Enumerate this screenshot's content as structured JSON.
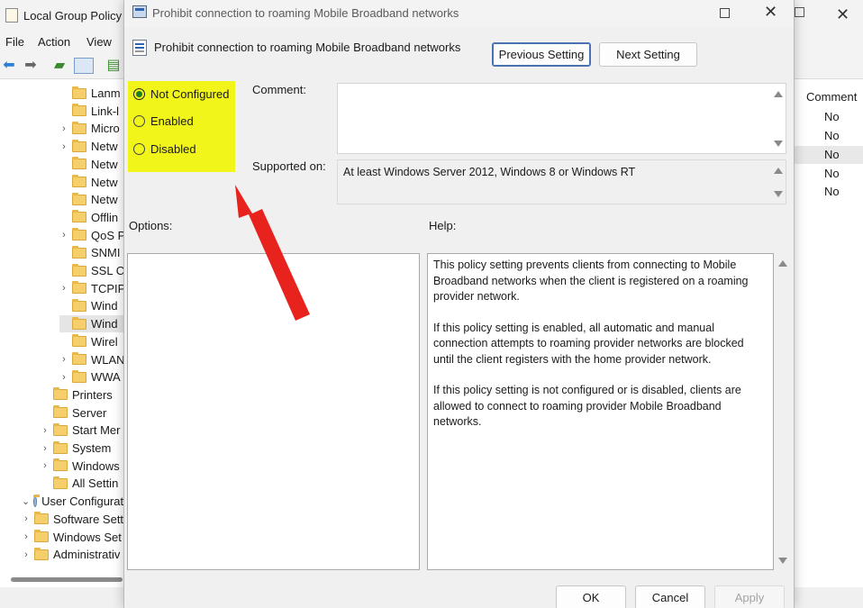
{
  "bg_window": {
    "title": "Local Group Policy",
    "close_glyph": "✕",
    "menu": [
      "File",
      "Action",
      "View"
    ],
    "toolbar_icons": [
      "back-arrow-icon",
      "forward-arrow-icon",
      "up-folder-icon",
      "show-hide-tree-icon",
      "export-list-icon"
    ]
  },
  "tree": {
    "items": [
      {
        "label": "Lanm",
        "chevron": false
      },
      {
        "label": "Link-l",
        "chevron": false
      },
      {
        "label": "Micro",
        "chevron": true
      },
      {
        "label": "Netw",
        "chevron": true
      },
      {
        "label": "Netw",
        "chevron": false
      },
      {
        "label": "Netw",
        "chevron": false
      },
      {
        "label": "Netw",
        "chevron": false
      },
      {
        "label": "Offlin",
        "chevron": false
      },
      {
        "label": "QoS P",
        "chevron": true
      },
      {
        "label": "SNMI",
        "chevron": false
      },
      {
        "label": "SSL C",
        "chevron": false
      },
      {
        "label": "TCPIP",
        "chevron": true
      },
      {
        "label": "Wind",
        "chevron": false
      },
      {
        "label": "Wind",
        "chevron": false,
        "selected": true
      },
      {
        "label": "Wirel",
        "chevron": false
      },
      {
        "label": "WLAN",
        "chevron": true
      },
      {
        "label": "WWA",
        "chevron": true
      },
      {
        "label": "Printers",
        "chevron": false
      },
      {
        "label": "Server",
        "chevron": false
      },
      {
        "label": "Start Mer",
        "chevron": true
      },
      {
        "label": "System",
        "chevron": true
      },
      {
        "label": "Windows",
        "chevron": true
      },
      {
        "label": "All Settin",
        "chevron": false
      },
      {
        "label": "User Configurati",
        "chevron": true
      },
      {
        "label": "Software Setti",
        "chevron": true
      },
      {
        "label": "Windows Set",
        "chevron": true
      },
      {
        "label": "Administrativ",
        "chevron": true
      }
    ]
  },
  "right_list": {
    "header": "Comment",
    "rows": [
      "No",
      "No",
      "No",
      "No",
      "No"
    ]
  },
  "dialog": {
    "title": "Prohibit connection to roaming Mobile Broadband networks",
    "policy_name": "Prohibit connection to roaming Mobile Broadband networks",
    "maximize_glyph": "□",
    "close_glyph": "✕",
    "previous_setting": "Previous Setting",
    "next_setting": "Next Setting",
    "radio_options": [
      {
        "label": "Not Configured",
        "checked": true
      },
      {
        "label": "Enabled",
        "checked": false
      },
      {
        "label": "Disabled",
        "checked": false
      }
    ],
    "comment_label": "Comment:",
    "comment_value": "",
    "supported_on_label": "Supported on:",
    "supported_on_value": "At least Windows Server 2012, Windows 8 or Windows RT",
    "options_label": "Options:",
    "help_label": "Help:",
    "help_paragraphs": [
      "This policy setting prevents clients from connecting to Mobile Broadband networks when the client is registered on a roaming provider network.",
      "If this policy setting is enabled, all automatic and manual connection attempts to roaming provider networks are blocked until the client registers with the home provider network.",
      "If this policy setting is not configured or is disabled, clients are allowed to connect to roaming provider Mobile Broadband networks."
    ],
    "ok": "OK",
    "cancel": "Cancel",
    "apply": "Apply"
  },
  "colors": {
    "highlight": "#f2f51a",
    "annotation_arrow": "#e8231e",
    "radio_checked": "#1a7f22"
  }
}
